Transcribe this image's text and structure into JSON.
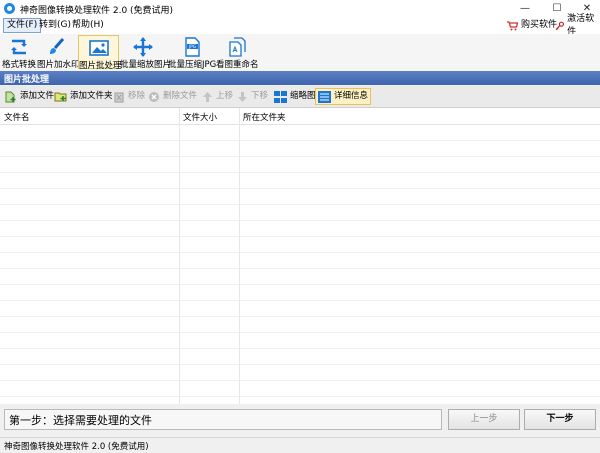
{
  "window": {
    "title": "神奇图像转换处理软件 2.0 (免费试用)",
    "minimize": "—",
    "maximize": "☐",
    "close": "✕"
  },
  "menu": {
    "file": "文件(F)",
    "goto": "转到(G)",
    "help": "帮助(H)",
    "buy": "购买软件",
    "activate": "激活软件"
  },
  "toolbar": [
    {
      "label": "格式转换",
      "icon": "convert-arrows-icon"
    },
    {
      "label": "图片加水印",
      "icon": "brush-icon"
    },
    {
      "label": "图片批处理",
      "icon": "image-icon",
      "active": true
    },
    {
      "label": "批量缩放图片",
      "icon": "move-arrows-icon"
    },
    {
      "label": "批量压缩JPG",
      "icon": "jpg-file-icon"
    },
    {
      "label": "看图重命名",
      "icon": "rename-files-icon"
    }
  ],
  "section": {
    "title": "图片批处理"
  },
  "actions": {
    "add_file": "添加文件",
    "add_folder": "添加文件夹",
    "remove": "移除",
    "delete_file": "删除文件",
    "move_up": "上移",
    "move_down": "下移",
    "thumbnail": "缩略图",
    "details": "详细信息"
  },
  "grid": {
    "columns": [
      "文件名",
      "文件大小",
      "所在文件夹"
    ]
  },
  "bottom": {
    "step_text": "第一步：选择需要处理的文件",
    "prev": "上一步",
    "next": "下一步"
  },
  "status": {
    "text": "神奇图像转换处理软件 2.0 (免费试用)"
  },
  "colors": {
    "accent": "#3d64ad",
    "toolbar_active": "#fdf6d8"
  }
}
